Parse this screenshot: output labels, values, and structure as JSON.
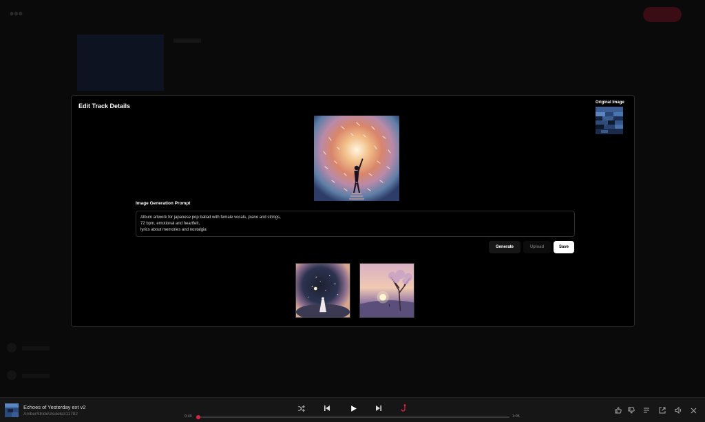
{
  "modal": {
    "title": "Edit Track Details",
    "original_image_label": "Original Image",
    "prompt_label": "Image Generation Prompt",
    "prompt_text": "Album artwork for japanese pop ballad with female vocals, piano and strings,\n72 bpm, emotional and heartfelt,\nlyrics about memories and nostalgia",
    "buttons": {
      "generate": "Generate",
      "upload": "Upload",
      "save": "Save"
    }
  },
  "player": {
    "track_title": "Echoes of Yesterday ext v2",
    "artist": "AmberStrideUkulele311782",
    "elapsed": "0:46",
    "duration": "1:05",
    "progress": 0.0,
    "accent_color": "#e5223f"
  },
  "icons": {
    "shuffle": "shuffle-icon",
    "prev": "skip-back-icon",
    "play": "play-icon",
    "next": "skip-forward-icon",
    "repeat": "hook-icon",
    "like": "thumbs-up-icon",
    "dislike": "thumbs-down-icon",
    "queue": "queue-icon",
    "share": "external-link-icon",
    "volume": "volume-icon",
    "close": "close-icon"
  }
}
